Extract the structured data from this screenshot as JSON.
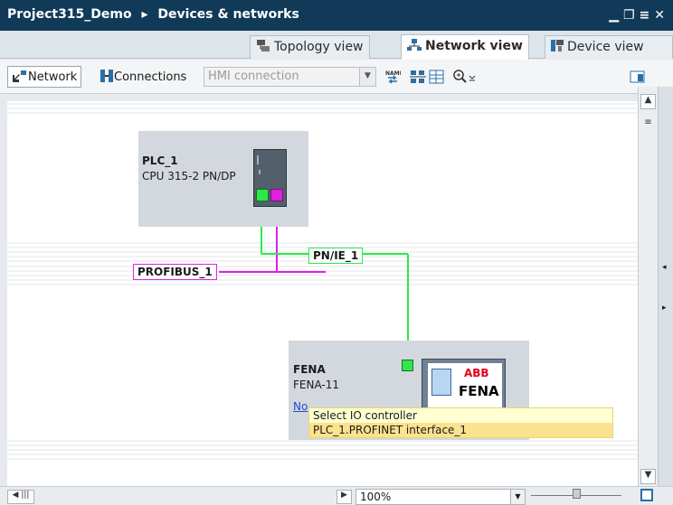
{
  "window": {
    "title_project": "Project315_Demo",
    "title_separator": "▸",
    "title_section": "Devices & networks"
  },
  "view_tabs": [
    {
      "label": "Topology view",
      "active": false,
      "icon": "topology-icon"
    },
    {
      "label": "Network view",
      "active": true,
      "icon": "network-icon"
    },
    {
      "label": "Device view",
      "active": false,
      "icon": "device-icon"
    }
  ],
  "toolbar": {
    "network_label": "Network",
    "connections_label": "Connections",
    "connection_type": "HMI connection"
  },
  "devices": [
    {
      "name": "PLC_1",
      "type": "CPU 315-2 PN/DP"
    },
    {
      "name": "FENA",
      "type": "FENA-11",
      "link_text": "No",
      "logo_text": "ABB",
      "module_label": "FENA"
    }
  ],
  "networks": {
    "profinet": "PN/IE_1",
    "profibus": "PROFIBUS_1"
  },
  "tooltip": {
    "header": "Select IO controller",
    "option": "PLC_1.PROFINET interface_1"
  },
  "statusbar": {
    "zoom": "100%"
  },
  "colors": {
    "titlebar": "#103a58",
    "profinet": "#2ee84a",
    "profibus": "#e020e0",
    "device_bg": "#d3d8de",
    "tooltip_bg": "#ffffd2",
    "tooltip_selected": "#fbe28f"
  }
}
